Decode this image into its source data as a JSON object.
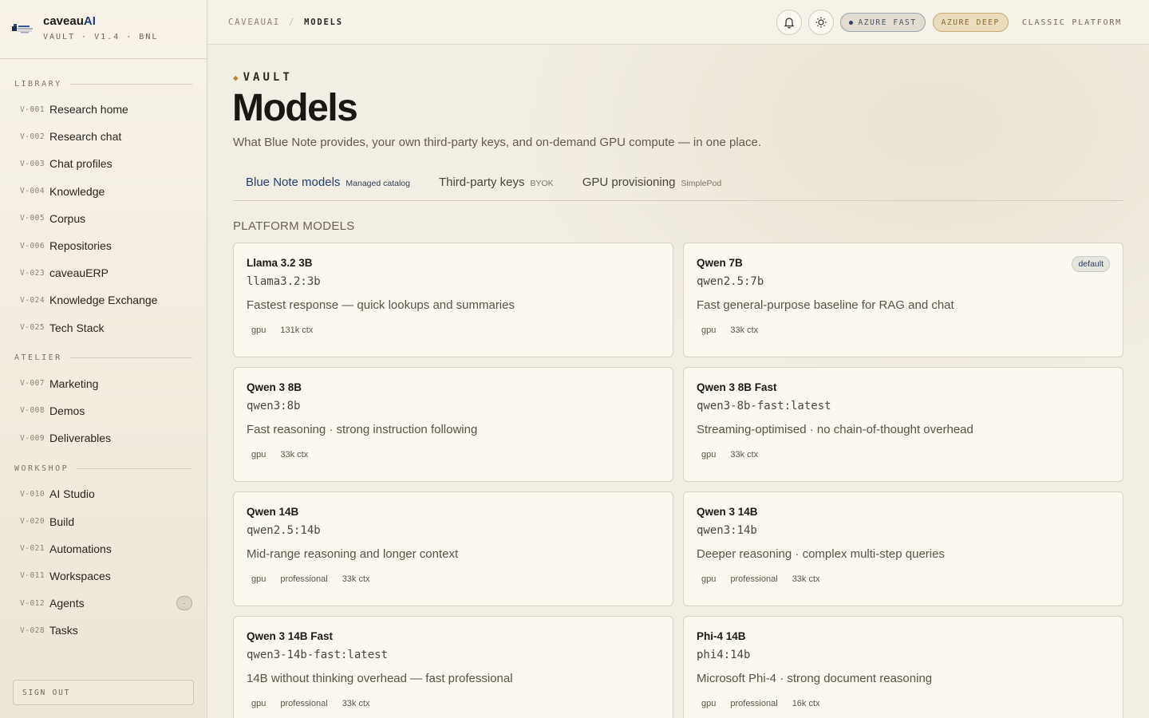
{
  "brand": {
    "name_main": "caveau",
    "name_ai": "AI",
    "subtitle": "VAULT · V1.4 · BNL"
  },
  "sidebar": {
    "sections": [
      {
        "title": "LIBRARY",
        "items": [
          {
            "code": "V-001",
            "label": "Research home"
          },
          {
            "code": "V-002",
            "label": "Research chat"
          },
          {
            "code": "V-003",
            "label": "Chat profiles"
          },
          {
            "code": "V-004",
            "label": "Knowledge"
          },
          {
            "code": "V-005",
            "label": "Corpus"
          },
          {
            "code": "V-006",
            "label": "Repositories"
          },
          {
            "code": "V-023",
            "label": "caveauERP"
          },
          {
            "code": "V-024",
            "label": "Knowledge Exchange"
          },
          {
            "code": "V-025",
            "label": "Tech Stack"
          }
        ]
      },
      {
        "title": "ATELIER",
        "items": [
          {
            "code": "V-007",
            "label": "Marketing"
          },
          {
            "code": "V-008",
            "label": "Demos"
          },
          {
            "code": "V-009",
            "label": "Deliverables"
          }
        ]
      },
      {
        "title": "WORKSHOP",
        "items": [
          {
            "code": "V-010",
            "label": "AI Studio"
          },
          {
            "code": "V-020",
            "label": "Build"
          },
          {
            "code": "V-021",
            "label": "Automations"
          },
          {
            "code": "V-011",
            "label": "Workspaces"
          },
          {
            "code": "V-012",
            "label": "Agents",
            "badge": "·"
          },
          {
            "code": "V-028",
            "label": "Tasks"
          }
        ]
      }
    ],
    "signout_label": "SIGN OUT"
  },
  "topbar": {
    "breadcrumb_root": "CAVEAUAI",
    "breadcrumb_sep": "/",
    "breadcrumb_current": "MODELS",
    "pill_fast": "AZURE FAST",
    "pill_deep": "AZURE DEEP",
    "classic_link": "CLASSIC PLATFORM"
  },
  "page": {
    "eyebrow_glyph": "◆",
    "eyebrow": "VAULT",
    "title": "Models",
    "subtitle": "What Blue Note provides, your own third-party keys, and on-demand GPU compute — in one place.",
    "tabs": [
      {
        "label": "Blue Note models",
        "tag": "Managed catalog",
        "active": true
      },
      {
        "label": "Third-party keys",
        "tag": "BYOK",
        "active": false
      },
      {
        "label": "GPU provisioning",
        "tag": "SimplePod",
        "active": false
      }
    ],
    "section_heading": "PLATFORM MODELS",
    "models": [
      {
        "name": "Llama 3.2 3B",
        "id": "llama3.2:3b",
        "desc": "Fastest response — quick lookups and summaries",
        "tags": [
          "gpu",
          "131k ctx"
        ]
      },
      {
        "name": "Qwen 7B",
        "id": "qwen2.5:7b",
        "desc": "Fast general-purpose baseline for RAG and chat",
        "tags": [
          "gpu",
          "33k ctx"
        ],
        "badge": "default"
      },
      {
        "name": "Qwen 3 8B",
        "id": "qwen3:8b",
        "desc": "Fast reasoning · strong instruction following",
        "tags": [
          "gpu",
          "33k ctx"
        ]
      },
      {
        "name": "Qwen 3 8B Fast",
        "id": "qwen3-8b-fast:latest",
        "desc": "Streaming-optimised · no chain-of-thought overhead",
        "tags": [
          "gpu",
          "33k ctx"
        ]
      },
      {
        "name": "Qwen 14B",
        "id": "qwen2.5:14b",
        "desc": "Mid-range reasoning and longer context",
        "tags": [
          "gpu",
          "professional",
          "33k ctx"
        ]
      },
      {
        "name": "Qwen 3 14B",
        "id": "qwen3:14b",
        "desc": "Deeper reasoning · complex multi-step queries",
        "tags": [
          "gpu",
          "professional",
          "33k ctx"
        ]
      },
      {
        "name": "Qwen 3 14B Fast",
        "id": "qwen3-14b-fast:latest",
        "desc": "14B without thinking overhead — fast professional",
        "tags": [
          "gpu",
          "professional",
          "33k ctx"
        ]
      },
      {
        "name": "Phi-4 14B",
        "id": "phi4:14b",
        "desc": "Microsoft Phi-4 · strong document reasoning",
        "tags": [
          "gpu",
          "professional",
          "16k ctx"
        ]
      }
    ]
  },
  "icons": {
    "bell": "bell-icon",
    "theme": "sun-icon",
    "logo": "bluenote-logo"
  },
  "colors": {
    "accent_blue": "#1f3f73",
    "gold": "#b8862c",
    "background": "#f3eee3"
  }
}
